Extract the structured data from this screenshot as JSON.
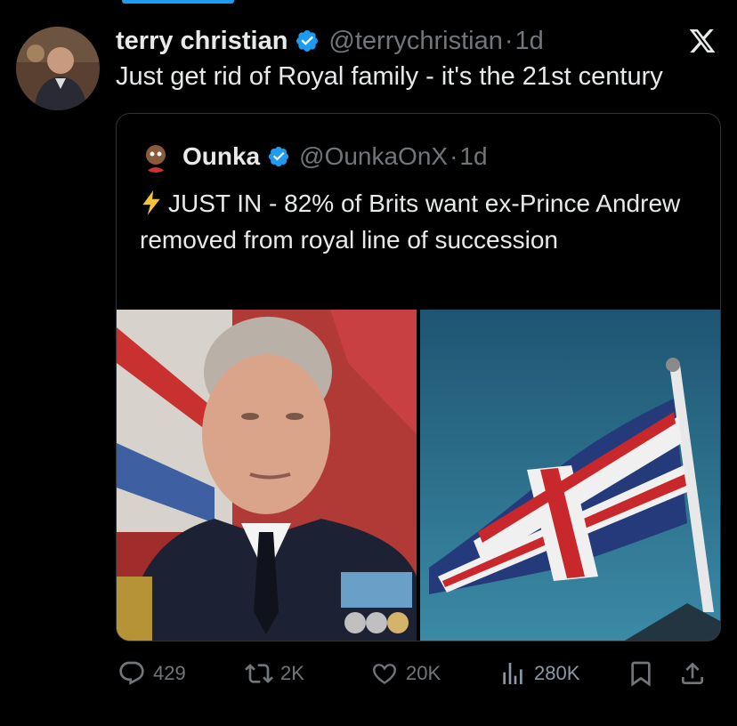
{
  "tweet": {
    "author_name": "terry christian",
    "author_handle": "@terrychristian",
    "time": "1d",
    "separator": "·",
    "text": "Just get rid of Royal family - it's the 21st century"
  },
  "quoted": {
    "author_name": "Ounka",
    "author_handle": "@OunkaOnX",
    "time": "1d",
    "separator": "·",
    "text": "JUST IN - 82% of Brits want ex-Prince Andrew removed from royal line of succession"
  },
  "actions": {
    "replies": "429",
    "reposts": "2K",
    "likes": "20K",
    "views": "280K"
  },
  "colors": {
    "accent": "#1d9bf0",
    "muted": "#71767b",
    "text": "#e7e9ea",
    "bolt": "#f5c33b"
  },
  "icons": [
    "verified-badge-icon",
    "x-logo-icon",
    "lightning-icon",
    "reply-icon",
    "repost-icon",
    "like-icon",
    "views-icon",
    "bookmark-icon",
    "share-icon"
  ]
}
